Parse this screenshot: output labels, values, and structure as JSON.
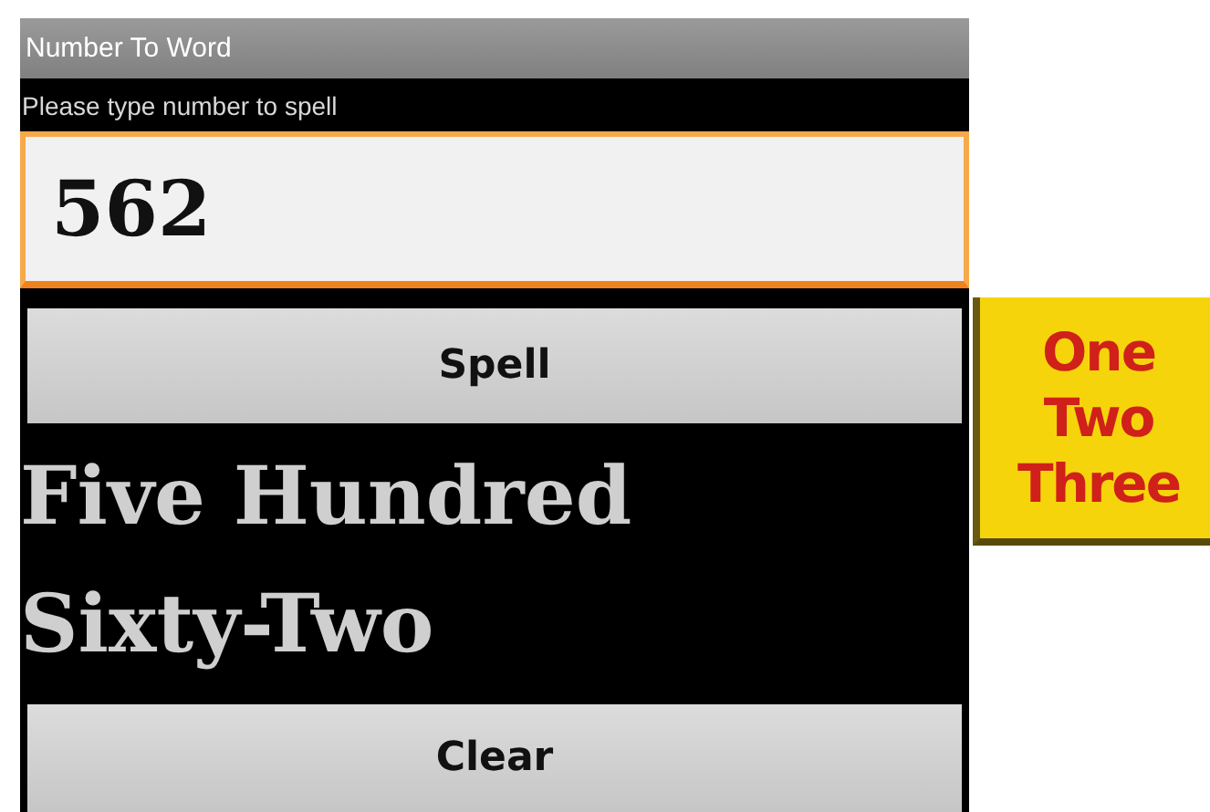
{
  "window": {
    "title": "Number To Word"
  },
  "prompt": "Please type number to spell",
  "number_field": {
    "value": "562",
    "focused": true
  },
  "spell_button": "Spell",
  "result": "Five Hundred Sixty-Two",
  "clear_button": "Clear",
  "logo": {
    "lines": [
      "One",
      "Two",
      "Three"
    ]
  }
}
